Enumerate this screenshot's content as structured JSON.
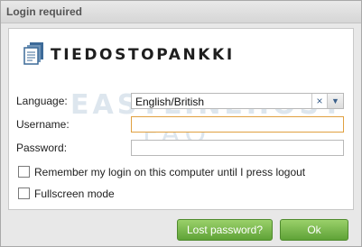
{
  "window": {
    "title": "Login required"
  },
  "logo": {
    "text": "TIEDOSTOPANKKI"
  },
  "watermark": {
    "line1": "EASYLINEHOST",
    "line2": "FAQ"
  },
  "form": {
    "language": {
      "label": "Language:",
      "value": "English/British",
      "clear_glyph": "×",
      "arrow_glyph": "▼"
    },
    "username": {
      "label": "Username:",
      "value": ""
    },
    "password": {
      "label": "Password:",
      "value": ""
    },
    "remember": {
      "label": "Remember my login on this computer until I press logout",
      "checked": false
    },
    "fullscreen": {
      "label": "Fullscreen mode",
      "checked": false
    }
  },
  "buttons": {
    "lost_password": "Lost password?",
    "ok": "Ok"
  },
  "colors": {
    "button_green": "#6fb241",
    "focus_border": "#e0a040",
    "dialog_bg": "#e8e8e8"
  }
}
